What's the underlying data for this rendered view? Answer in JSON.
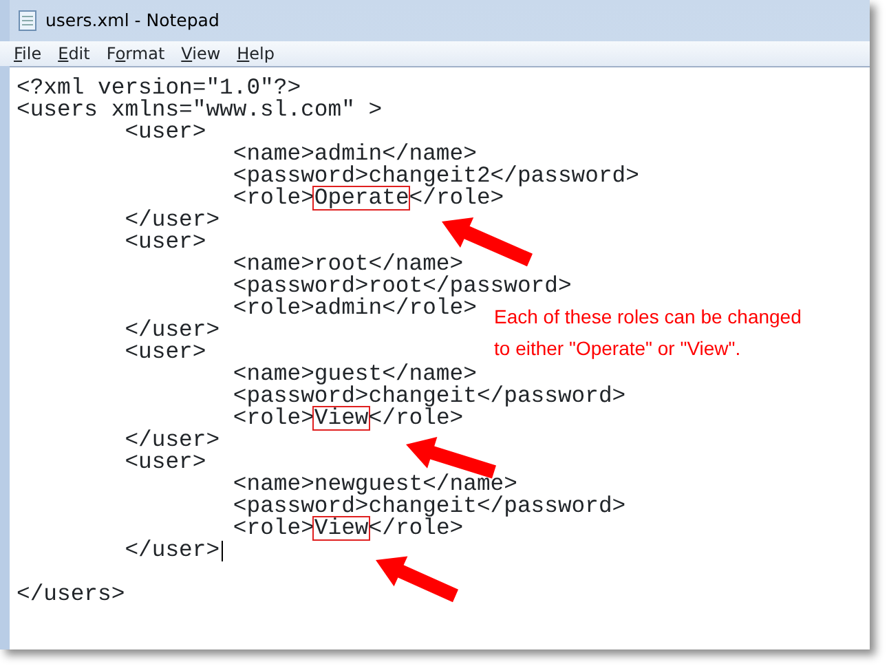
{
  "window": {
    "title": "users.xml - Notepad"
  },
  "menu": [
    {
      "key": "F",
      "rest": "ile"
    },
    {
      "key": "E",
      "rest": "dit"
    },
    {
      "lead": "F",
      "key": "o",
      "rest": "rmat"
    },
    {
      "key": "V",
      "rest": "iew"
    },
    {
      "key": "H",
      "rest": "elp"
    }
  ],
  "lines": [
    {
      "text": "<?xml version=\"1.0\"?>"
    },
    {
      "text": "<users xmlns=\"www.sl.com\" >"
    },
    {
      "text": "\t<user>"
    },
    {
      "text": "\t\t<name>admin</name>"
    },
    {
      "text": "\t\t<password>changeit2</password>"
    },
    {
      "text": "\t\t<role>",
      "highlight": "Operate",
      "after": "</role>"
    },
    {
      "text": "\t</user>"
    },
    {
      "text": "\t<user>"
    },
    {
      "text": "\t\t<name>root</name>"
    },
    {
      "text": "\t\t<password>root</password>"
    },
    {
      "text": "\t\t<role>admin</role>"
    },
    {
      "text": "\t</user>"
    },
    {
      "text": "\t<user>"
    },
    {
      "text": "\t\t<name>guest</name>"
    },
    {
      "text": "\t\t<password>changeit</password>"
    },
    {
      "text": "\t\t<role>",
      "highlight": "View",
      "after": "</role>"
    },
    {
      "text": "\t</user>"
    },
    {
      "text": "\t<user>"
    },
    {
      "text": "\t\t<name>newguest</name>"
    },
    {
      "text": "\t\t<password>changeit</password>"
    },
    {
      "text": "\t\t<role>",
      "highlight": "View",
      "after": "</role>"
    },
    {
      "text": "\t</user>",
      "cursor": true
    },
    {
      "text": "</users>",
      "blank_before": true
    }
  ],
  "callout": [
    "Each of these roles can be changed",
    "to either \"Operate\" or \"View\"."
  ]
}
